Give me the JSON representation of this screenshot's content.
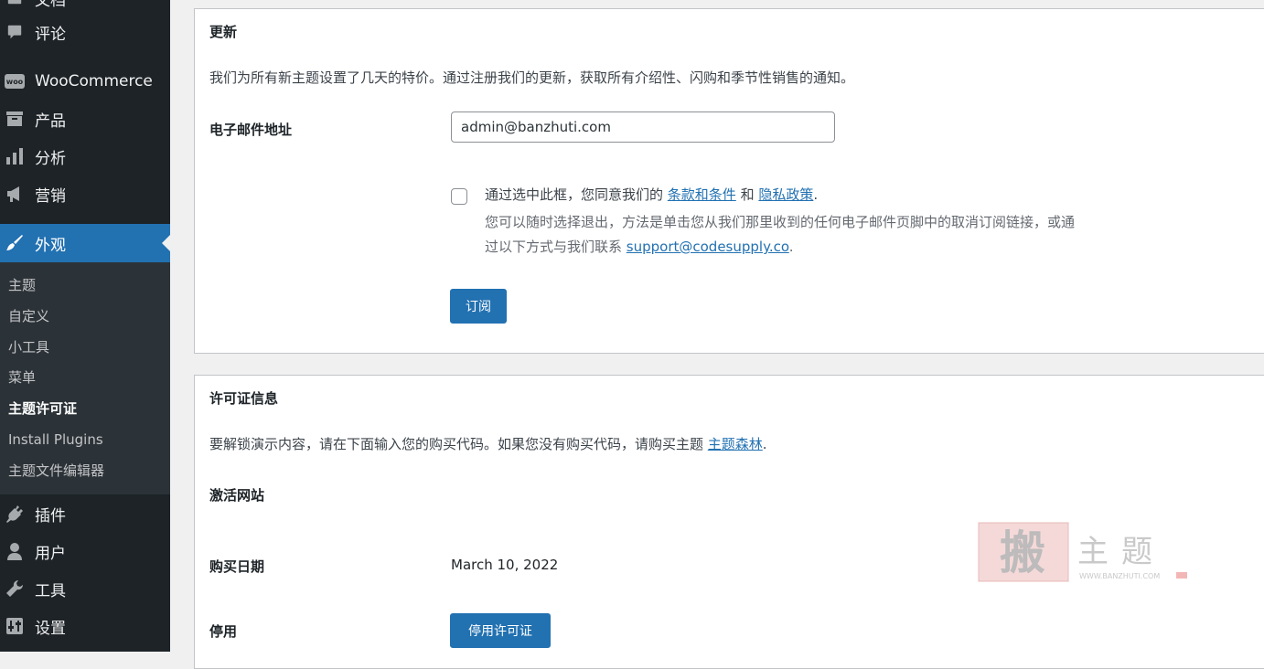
{
  "sidebar": {
    "items": [
      {
        "label": "文档",
        "icon": "media-icon"
      },
      {
        "label": "评论",
        "icon": "comment-icon"
      },
      {
        "label": "WooCommerce",
        "icon": "woocommerce-icon"
      },
      {
        "label": "产品",
        "icon": "archive-icon"
      },
      {
        "label": "分析",
        "icon": "bar-chart-icon"
      },
      {
        "label": "营销",
        "icon": "megaphone-icon"
      },
      {
        "label": "外观",
        "icon": "paintbrush-icon"
      },
      {
        "label": "插件",
        "icon": "plugin-icon"
      },
      {
        "label": "用户",
        "icon": "user-icon"
      },
      {
        "label": "工具",
        "icon": "wrench-icon"
      },
      {
        "label": "设置",
        "icon": "settings-icon"
      }
    ],
    "woo_badge": "woo",
    "submenu": [
      "主题",
      "自定义",
      "小工具",
      "菜单",
      "主题许可证",
      "Install Plugins",
      "主题文件编辑器"
    ]
  },
  "updates": {
    "title": "更新",
    "description": "我们为所有新主题设置了几天的特价。通过注册我们的更新，获取所有介绍性、闪购和季节性销售的通知。",
    "email_label": "电子邮件地址",
    "email_value": "admin@banzhuti.com",
    "consent_prefix": "通过选中此框，您同意我们的 ",
    "terms_link": "条款和条件",
    "consent_and": " 和 ",
    "privacy_link": "隐私政策",
    "consent_suffix": ".",
    "optout_line1": "您可以随时选择退出，方法是单击您从我们那里收到的任何电子邮件页脚中的取消订阅链接，或通",
    "optout_line2_prefix": "过以下方式与我们联系 ",
    "support_email": "support@codesupply.co",
    "optout_line2_suffix": ".",
    "subscribe_button": "订阅"
  },
  "license": {
    "title": "许可证信息",
    "description_prefix": "要解锁演示内容，请在下面输入您的购买代码。如果您没有购买代码，请购买主题 ",
    "description_link": "主题森林",
    "description_suffix": ".",
    "activated_site_label": "激活网站",
    "purchase_date_label": "购买日期",
    "purchase_date_value": "March 10, 2022",
    "deactivate_label": "停用",
    "deactivate_button": "停用许可证"
  },
  "watermark": {
    "brand": "搬主题",
    "url": "WWW.BANZHUTI.COM"
  }
}
